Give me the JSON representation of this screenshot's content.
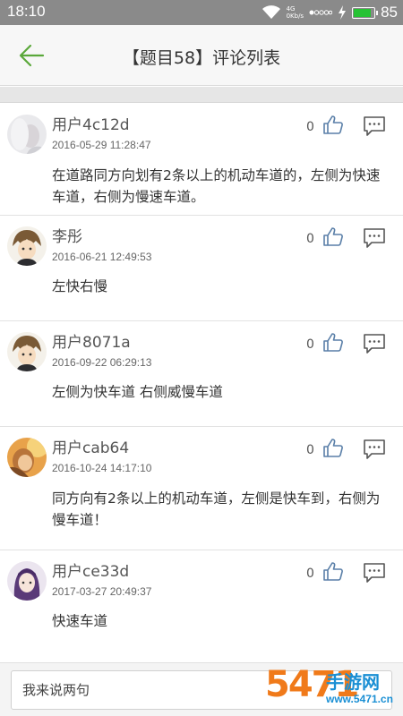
{
  "status_bar": {
    "time": "18:10",
    "network_top": "4G",
    "network_bottom": "0Kb/s",
    "battery": "85",
    "battery_level": 0.85
  },
  "header": {
    "title": "【题目58】评论列表"
  },
  "comments": [
    {
      "username": "用户4c12d",
      "time": "2016-05-29 11:28:47",
      "likes": "0",
      "text": "在道路同方向划有2条以上的机动车道的，左侧为快速车道，右侧为慢速车道。"
    },
    {
      "username": "李彤",
      "time": "2016-06-21 12:49:53",
      "likes": "0",
      "text": "左快右慢"
    },
    {
      "username": "用户8071a",
      "time": "2016-09-22 06:29:13",
      "likes": "0",
      "text": "左侧为快车道 右侧威慢车道"
    },
    {
      "username": "用户cab64",
      "time": "2016-10-24 14:17:10",
      "likes": "0",
      "text": "同方向有2条以上的机动车道，左侧是快车到，右侧为慢车道！"
    },
    {
      "username": "用户ce33d",
      "time": "2017-03-27 20:49:37",
      "likes": "0",
      "text": "快速车道"
    }
  ],
  "input": {
    "placeholder": "我来说两句"
  },
  "watermark": {
    "digits": "5471",
    "name": "手游网",
    "url": "www.5471.cn"
  },
  "colors": {
    "accent": "#5aa83a",
    "watermark_orange": "#f07a1a",
    "watermark_blue": "#1a8fd4"
  }
}
